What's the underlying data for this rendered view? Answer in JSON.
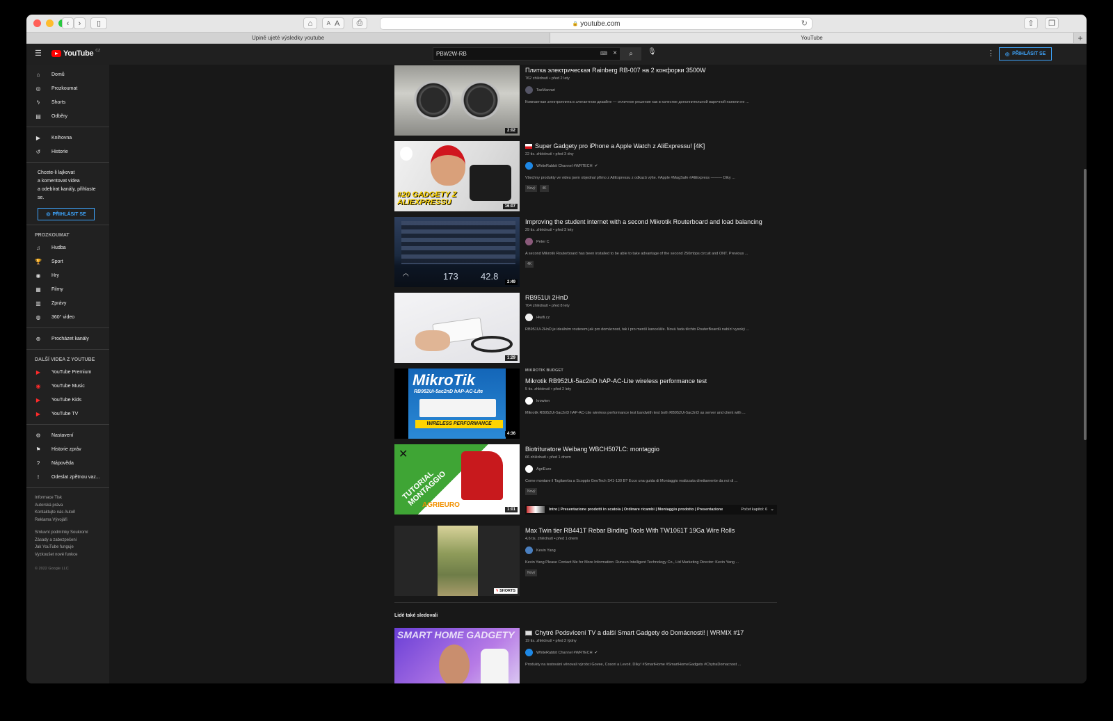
{
  "browser": {
    "url": "youtube.com",
    "tabs": [
      {
        "label": "Upině ujeté výsledky youtube",
        "active": false
      },
      {
        "label": "YouTube",
        "active": true
      }
    ],
    "reader_small": "A",
    "reader_large": "A"
  },
  "header": {
    "logo_text": "YouTube",
    "logo_country": "CZ",
    "search_value": "PBW2W-RB",
    "signin_label": "PŘIHLÁSIT SE"
  },
  "sidebar": {
    "main_items": [
      {
        "label": "Domů",
        "icon": "home-icon"
      },
      {
        "label": "Prozkoumat",
        "icon": "compass-icon"
      },
      {
        "label": "Shorts",
        "icon": "shorts-icon"
      },
      {
        "label": "Odběry",
        "icon": "subscriptions-icon"
      }
    ],
    "library_items": [
      {
        "label": "Knihovna",
        "icon": "library-icon"
      },
      {
        "label": "Historie",
        "icon": "history-icon"
      }
    ],
    "signin_prompt_lines": [
      "Chcete-li lajkovat",
      "a komentovat videa",
      "a odebírat kanály, přihlaste",
      "se."
    ],
    "signin_button": "PŘIHLÁSIT SE",
    "explore_heading": "PROZKOUMAT",
    "explore_items": [
      {
        "label": "Hudba",
        "icon": "music-icon"
      },
      {
        "label": "Sport",
        "icon": "trophy-icon"
      },
      {
        "label": "Hry",
        "icon": "gamepad-icon"
      },
      {
        "label": "Filmy",
        "icon": "film-icon"
      },
      {
        "label": "Zprávy",
        "icon": "news-icon"
      },
      {
        "label": "360° video",
        "icon": "360-icon"
      }
    ],
    "browse_channels": "Procházet kanály",
    "more_heading": "DALŠÍ VIDEA Z YOUTUBE",
    "more_items": [
      {
        "label": "YouTube Premium",
        "icon": "youtube-premium-icon"
      },
      {
        "label": "YouTube Music",
        "icon": "youtube-music-icon"
      },
      {
        "label": "YouTube Kids",
        "icon": "youtube-kids-icon"
      },
      {
        "label": "YouTube TV",
        "icon": "youtube-tv-icon"
      }
    ],
    "settings_items": [
      {
        "label": "Nastavení",
        "icon": "gear-icon"
      },
      {
        "label": "Historie zpráv",
        "icon": "flag-icon"
      },
      {
        "label": "Nápověda",
        "icon": "help-icon"
      },
      {
        "label": "Odeslat zpětnou vaz...",
        "icon": "feedback-icon"
      }
    ],
    "footer_links_1": [
      "Informace  Tisk",
      "Autorská práva",
      "Kontaktujte nás  Autoři",
      "Reklama  Vývojáři"
    ],
    "footer_links_2": [
      "Smluvní podmínky  Soukromí",
      "Zásady a zabezpečení",
      "Jak YouTube funguje",
      "Vyzkoušet nové funkce"
    ],
    "copyright": "© 2022 Google LLC"
  },
  "results": [
    {
      "title": "Плитка электрическая Rainberg RB-007 на 2 конфорки 3500W",
      "meta": "762 zhlédnutí • před 2 lety",
      "channel": "TaxMarvari",
      "desc": "Компактная электроплита в элегантном дизайне — отличное решение как в качестве дополнительной варочной панели не ...",
      "duration": "2:02",
      "badges": []
    },
    {
      "title": "Super Gadgety pro iPhone a Apple Watch z AliExpressu! [4K]",
      "meta": "22 tis. zhlédnutí • před 3 dny",
      "channel": "WhiteRabbit Channel #WRTECH",
      "desc": "Všechny produkty ve videu jsem objednal přímo z AliExpressu z odkazů výše. #Apple #MagSafe #AliExpress ——— Díky ...",
      "duration": "16:07",
      "badges": [
        "Nový",
        "4K"
      ]
    },
    {
      "title": "Improving the student internet with a second Mikrotik Routerboard and load balancing",
      "meta": "29 tis. zhlédnutí • před 3 lety",
      "channel": "Peter C",
      "desc": "A second Mikrotik Routerboard has been installed to be able to take advantage of the second 250mbps circuit and ONT. Previous ...",
      "duration": "2:49",
      "badges": [
        "4K"
      ]
    },
    {
      "title": "RB951Ui 2HnD",
      "meta": "704 zhlédnutí • před 8 lety",
      "channel": "i4wifi.cz",
      "desc": "RB951Ui-2HnD je ideálním routerem jak pro domácnost, tak i pro menší kanceláře. Nová řada těchto RouterBoardů nabízí vysoký ...",
      "duration": "1:29",
      "badges": []
    },
    {
      "kicker": "MIKROTIK BUDGET",
      "title": "Mikrotik RB952Ui-5ac2nD hAP-AC-Lite wireless performance test",
      "meta": "5 tis. zhlédnutí • před 2 lety",
      "channel": "krowten",
      "desc": "Mikrotik RB952Ui-5ac2nD hAP-AC-Lite wireless performance test bandwith test both RB952Ui-5ac2nD as server and client with ...",
      "duration": "4:36",
      "badges": []
    },
    {
      "title": "Biotrituratore Weibang WBCH507LC: montaggio",
      "meta": "66 zhlédnutí • před 1 dnem",
      "channel": "AgriEuro",
      "desc": "Come montare il Tagliaerba a Scoppio GeoTech S41-130 B? Ecco una guida di Montaggio realizzata direttamente da noi di ...",
      "duration": "1:01",
      "badges": [
        "Nový"
      ],
      "chapters_text": "Intro | Presentazione prodotti in scatola | Ordinare ricambi | Montaggio prodotto | Presentazione...",
      "chapters_count": "Počet kapitol: 6"
    },
    {
      "title": "Max Twin tier RB441T Rebar Binding Tools With TW1061T 19Ga Wire Rolls",
      "meta": "4,6 tis. zhlédnutí • před 1 dnem",
      "channel": "Kevin Yang",
      "desc": "Kevin Yang Please Contact Me for More Information: Runsun Intelligent Technology Co., Ltd Marketing Director: Kevin Yang ...",
      "shorts_label": "SHORTS",
      "badges": [
        "Nový"
      ]
    }
  ],
  "section": {
    "heading": "Lidé také sledovali",
    "item": {
      "title": "Chytré Podsvícení TV a další Smart Gadgety do Domácnosti! | WRMIX #17",
      "meta": "19 tis. zhlédnutí • před 2 týdny",
      "channel": "WhiteRabbit Channel #WRTECH",
      "desc": "Produkty na testování věnovali výrobci Govee, Cosori a Levoit. Díky! #SmartHome #SmartHomeGadgets #ChytraDomacnost ...",
      "thumb_text": "SMART HOME GADGETY"
    }
  },
  "thumb_text": {
    "aliexpress": "#20 GADGETY Z ALIEXPRESSU",
    "router_a": "173",
    "router_b": "42.8",
    "mikrotik_logo": "MikroTik",
    "mikrotik_model": "RB952Ui-5ac2nD  hAP-AC-Lite",
    "mikrotik_perf": "WIRELESS PERFORMANCE",
    "tutorial": "TUTORIAL MONTAGGIO",
    "agrieuro": "AGRIEURO"
  },
  "colors": {
    "accent_blue": "#3ea6ff",
    "youtube_red": "#ff0000",
    "bg_main": "#181818",
    "bg_sidebar": "#212121"
  }
}
